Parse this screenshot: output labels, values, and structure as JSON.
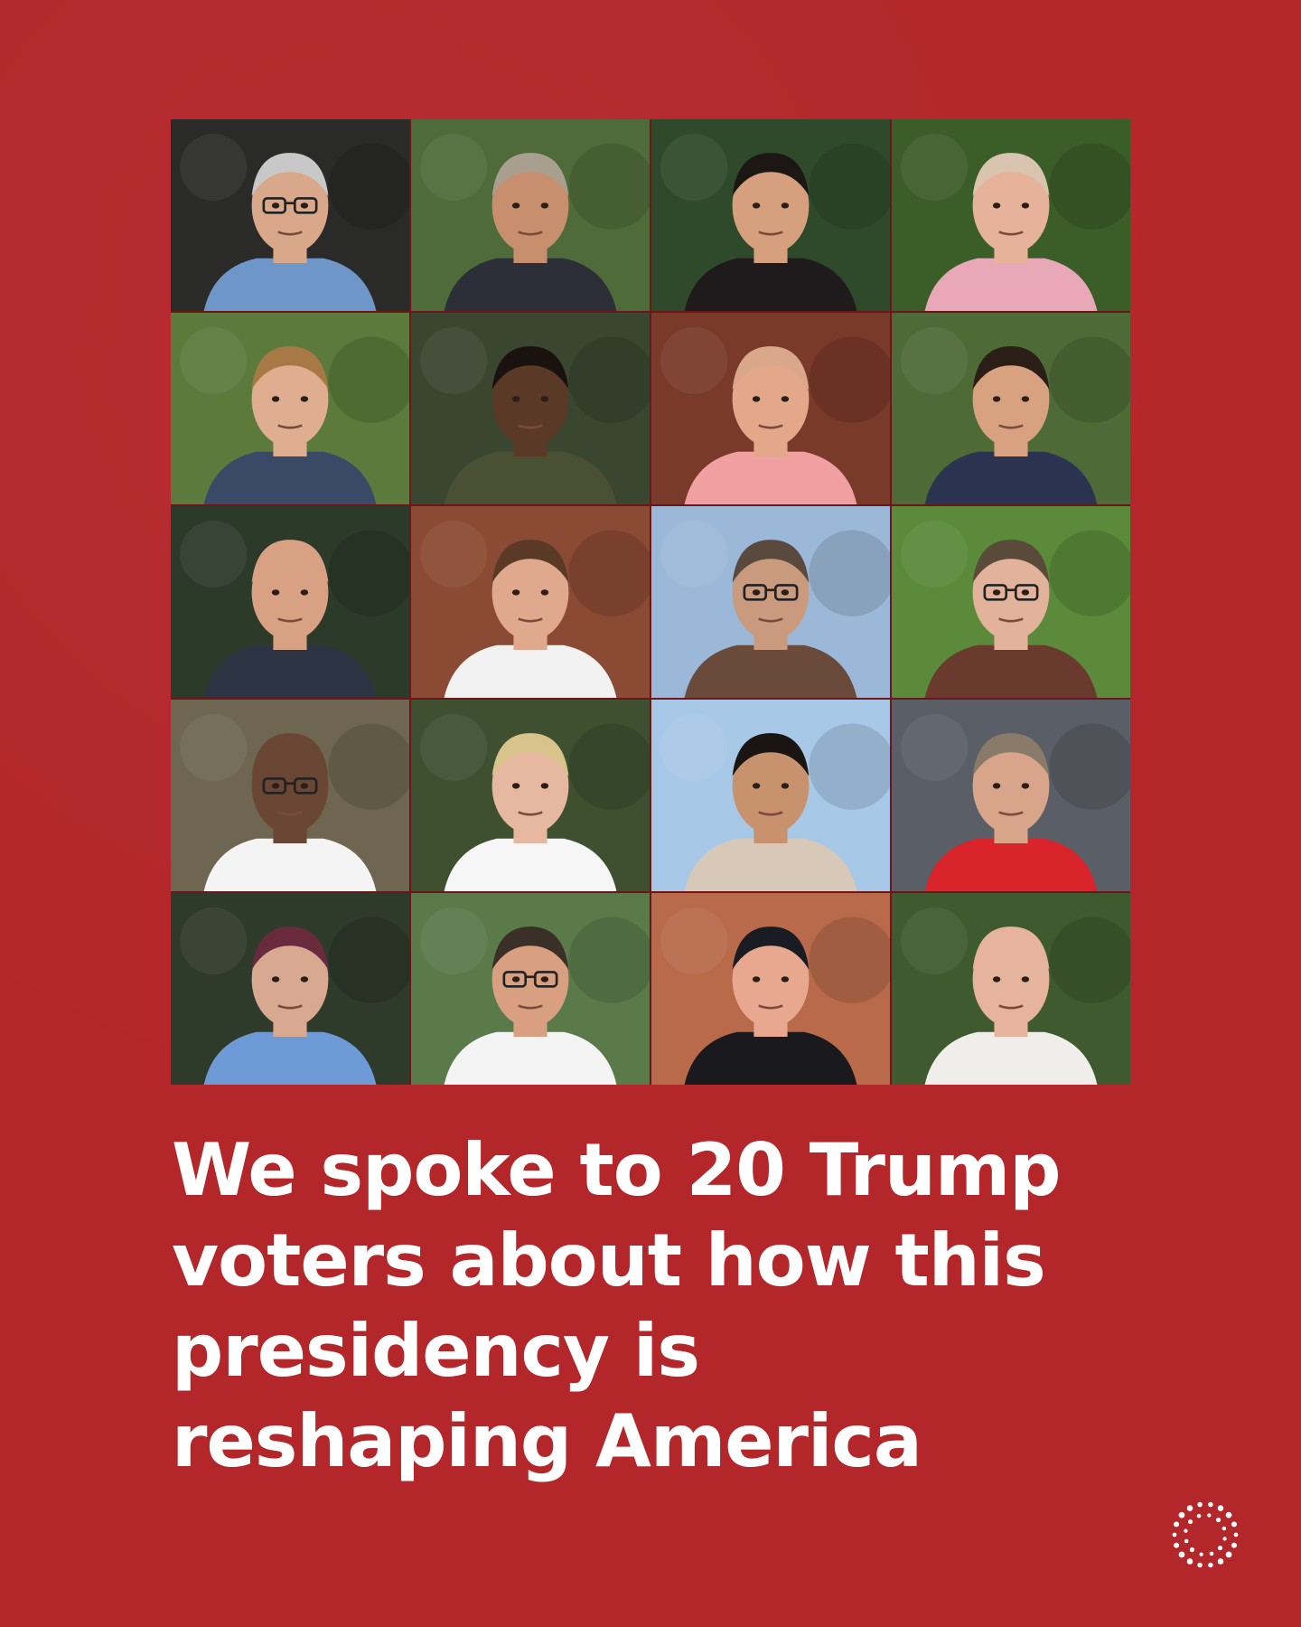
{
  "headline": "We spoke to 20 Trump voters about how this presidency is reshaping America",
  "colors": {
    "background": "#b3262a",
    "headline_text": "#ffffff"
  },
  "logo_icon": "dotted-circle-logo-icon",
  "portraits": [
    {
      "bg": "#2a2a28",
      "skin": "#d9a88a",
      "hair": "#c8c8c8",
      "shirt": "#6e96c8",
      "glasses": true
    },
    {
      "bg": "#4f6b3a",
      "skin": "#c88f6e",
      "hair": "#a89f8e",
      "shirt": "#2c2f38",
      "glasses": false
    },
    {
      "bg": "#2f4a2a",
      "skin": "#d6a07f",
      "hair": "#1c1614",
      "shirt": "#1f1a1c",
      "glasses": false
    },
    {
      "bg": "#3b5d28",
      "skin": "#e6b39a",
      "hair": "#d9c4b0",
      "shirt": "#e8a8b8",
      "glasses": false
    },
    {
      "bg": "#5b7a3c",
      "skin": "#dfae90",
      "hair": "#a77a45",
      "shirt": "#3a4a66",
      "glasses": false
    },
    {
      "bg": "#3a4630",
      "skin": "#5a3a26",
      "hair": "#1a120e",
      "shirt": "#4a5034",
      "glasses": false
    },
    {
      "bg": "#7a3a2a",
      "skin": "#e3a88a",
      "hair": "#d9a88a",
      "shirt": "#f0a0a0",
      "glasses": false
    },
    {
      "bg": "#4e6a36",
      "skin": "#d8a281",
      "hair": "#2a1e16",
      "shirt": "#2a3450",
      "glasses": false
    },
    {
      "bg": "#2c3a2a",
      "skin": "#d8a183",
      "hair": "#d8a183",
      "shirt": "#2c3444",
      "glasses": false
    },
    {
      "bg": "#8a4a34",
      "skin": "#e0a88c",
      "hair": "#5a3a26",
      "shirt": "#f2f2f2",
      "glasses": false
    },
    {
      "bg": "#9cb8d8",
      "skin": "#c99a7e",
      "hair": "#5a4a3e",
      "shirt": "#6a4a3a",
      "glasses": true
    },
    {
      "bg": "#5a8a3a",
      "skin": "#e3b29a",
      "hair": "#5a4a3a",
      "shirt": "#6a3a2e",
      "glasses": true
    },
    {
      "bg": "#6e6650",
      "skin": "#6a4634",
      "hair": "#6a4634",
      "shirt": "#f4f4f4",
      "glasses": true
    },
    {
      "bg": "#3e5030",
      "skin": "#e6b8a0",
      "hair": "#d8c48a",
      "shirt": "#f6f6f6",
      "glasses": false
    },
    {
      "bg": "#a8c8e8",
      "skin": "#c8926e",
      "hair": "#1a1412",
      "shirt": "#d8c8b8",
      "glasses": false
    },
    {
      "bg": "#5a5e66",
      "skin": "#d8a48a",
      "hair": "#8a7a6a",
      "shirt": "#d8242a",
      "glasses": false
    },
    {
      "bg": "#2e3a2a",
      "skin": "#d8a890",
      "hair": "#6a2a3e",
      "shirt": "#6f9ad8",
      "glasses": false
    },
    {
      "bg": "#5a7a4a",
      "skin": "#d8a080",
      "hair": "#3a3028",
      "shirt": "#f4f4f4",
      "glasses": true
    },
    {
      "bg": "#b86a4a",
      "skin": "#e8a890",
      "hair": "#1a1c24",
      "shirt": "#1a1a1e",
      "glasses": false
    },
    {
      "bg": "#3e5a2e",
      "skin": "#e6b49c",
      "hair": "#e6b49c",
      "shirt": "#f0eeea",
      "glasses": false
    }
  ]
}
